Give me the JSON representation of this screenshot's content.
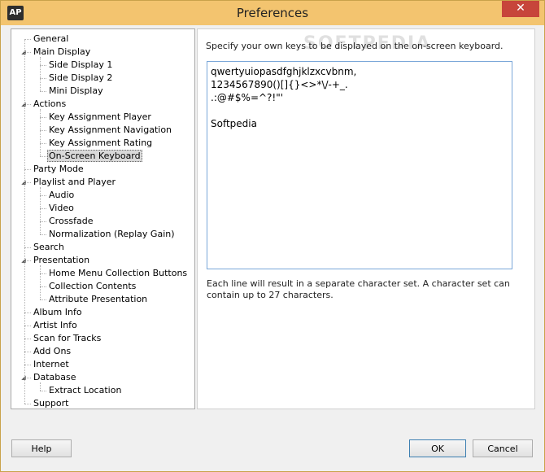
{
  "window": {
    "title": "Preferences",
    "app_icon": "AP",
    "close_glyph": "✕"
  },
  "watermark": "SOFTPEDIA",
  "tree": [
    {
      "label": "General",
      "level": 0,
      "expander": ""
    },
    {
      "label": "Main Display",
      "level": 0,
      "expander": "open"
    },
    {
      "label": "Side Display 1",
      "level": 1,
      "expander": ""
    },
    {
      "label": "Side Display 2",
      "level": 1,
      "expander": ""
    },
    {
      "label": "Mini Display",
      "level": 1,
      "expander": ""
    },
    {
      "label": "Actions",
      "level": 0,
      "expander": "open"
    },
    {
      "label": "Key Assignment Player",
      "level": 1,
      "expander": ""
    },
    {
      "label": "Key Assignment Navigation",
      "level": 1,
      "expander": ""
    },
    {
      "label": "Key Assignment Rating",
      "level": 1,
      "expander": ""
    },
    {
      "label": "On-Screen Keyboard",
      "level": 1,
      "expander": "",
      "selected": true
    },
    {
      "label": "Party Mode",
      "level": 0,
      "expander": ""
    },
    {
      "label": "Playlist and Player",
      "level": 0,
      "expander": "open"
    },
    {
      "label": "Audio",
      "level": 1,
      "expander": ""
    },
    {
      "label": "Video",
      "level": 1,
      "expander": ""
    },
    {
      "label": "Crossfade",
      "level": 1,
      "expander": ""
    },
    {
      "label": "Normalization (Replay Gain)",
      "level": 1,
      "expander": ""
    },
    {
      "label": "Search",
      "level": 0,
      "expander": ""
    },
    {
      "label": "Presentation",
      "level": 0,
      "expander": "open"
    },
    {
      "label": "Home Menu Collection Buttons",
      "level": 1,
      "expander": ""
    },
    {
      "label": "Collection Contents",
      "level": 1,
      "expander": ""
    },
    {
      "label": "Attribute Presentation",
      "level": 1,
      "expander": ""
    },
    {
      "label": "Album Info",
      "level": 0,
      "expander": ""
    },
    {
      "label": "Artist Info",
      "level": 0,
      "expander": ""
    },
    {
      "label": "Scan for Tracks",
      "level": 0,
      "expander": ""
    },
    {
      "label": "Add Ons",
      "level": 0,
      "expander": ""
    },
    {
      "label": "Internet",
      "level": 0,
      "expander": ""
    },
    {
      "label": "Database",
      "level": 0,
      "expander": "open"
    },
    {
      "label": "Extract Location",
      "level": 1,
      "expander": ""
    },
    {
      "label": "Support",
      "level": 0,
      "expander": ""
    }
  ],
  "panel": {
    "intro": "Specify your own keys to be displayed on the on-screen keyboard.",
    "keys_lines": [
      "qwertyuiopasdfghjklzxcvbnm,",
      "1234567890()[]{}<>*\\/-+_.",
      ".:@#$%=^?!\"'",
      "",
      "Softpedia"
    ],
    "note": "Each line will result in a separate character set. A character set can contain up to 27 characters."
  },
  "buttons": {
    "help": "Help",
    "ok": "OK",
    "cancel": "Cancel"
  }
}
